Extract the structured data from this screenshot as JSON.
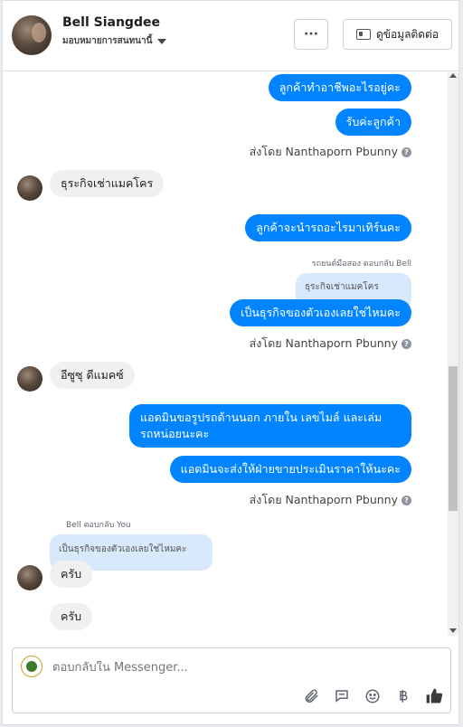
{
  "header": {
    "name": "Bell Siangdee",
    "subtitle": "มอบหมายการสนทนานี้",
    "more_label": "···",
    "info_label": "ดูข้อมูลติดต่อ"
  },
  "messages": {
    "m1": "ลูกค้าทำอาชีพอะไรอยู่คะ",
    "m2": "รับค่ะลูกค้า",
    "sent_by_1": "ส่งโดย Nanthaporn Pbunny",
    "m3": "ธุระกิจเช่าแมคโคร",
    "m4": "ลูกค้าจะนำรถอะไรมาเทิร์นคะ",
    "reply_label_1": "รถยนต์มือสอง ตอบกลับ Bell",
    "quote_1": "ธุระกิจเช่าแมคโคร",
    "m5": "เป็นธุรกิจของตัวเองเลยใช่ไหมคะ",
    "sent_by_2": "ส่งโดย Nanthaporn Pbunny",
    "m6": "อีซูซุ ดีแมคซ์",
    "m7_line1": "แอดมินขอรูปรถด้านนอก ภายใน เลขไมล์ และเล่ม",
    "m7_line2": "รถหน่อยนะคะ",
    "m8": "แอดมินจะส่งให้ฝ่ายขายประเมินราคาให้นะคะ",
    "sent_by_3": "ส่งโดย Nanthaporn Pbunny",
    "reply_label_2": "Bell ตอบกลับ You",
    "quote_2": "เป็นธุรกิจของตัวเองเลยใช่ไหมคะ",
    "m9": "ครับ",
    "m10": "ครับ"
  },
  "composer": {
    "placeholder": "ตอบกลับใน Messenger..."
  },
  "icons": {
    "attach": "paperclip-icon",
    "saved_reply": "chat-bubbles-icon",
    "emoji": "smiley-icon",
    "currency": "baht-icon",
    "like": "thumbs-up-icon"
  },
  "colors": {
    "outgoing": "#0084ff",
    "incoming": "#f0f0f0",
    "quote": "#d8e9fb"
  }
}
